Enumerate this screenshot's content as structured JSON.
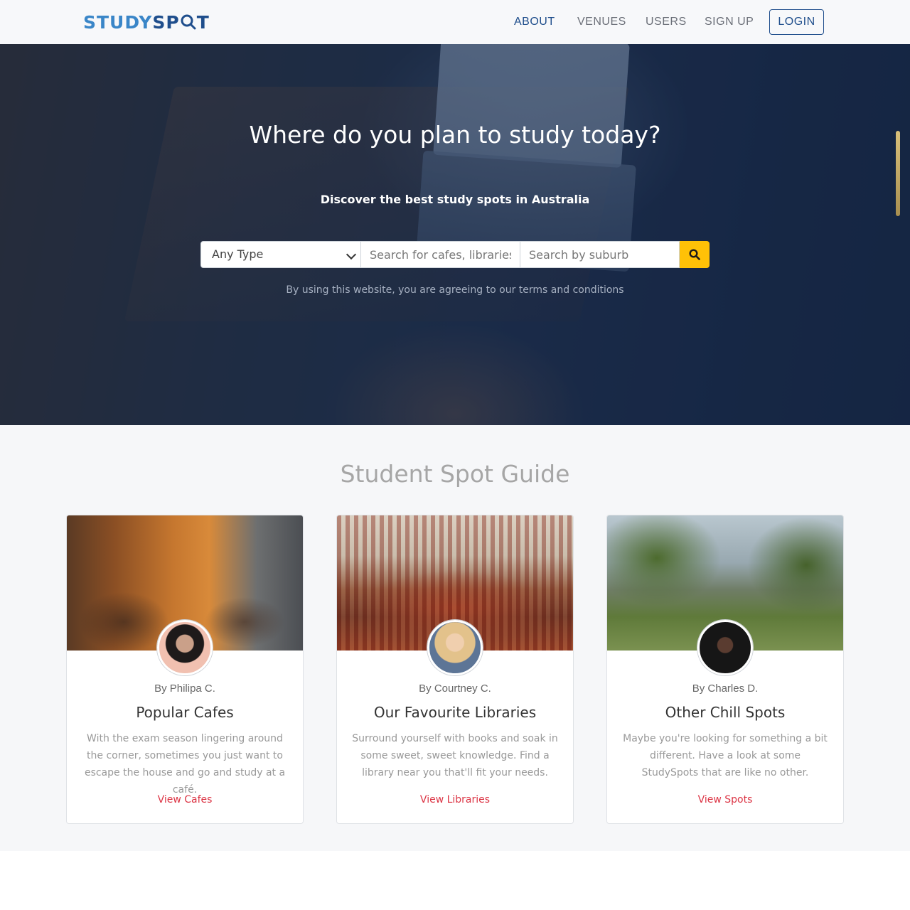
{
  "navbar": {
    "logo_part1": "STUDY",
    "logo_part2": "SP",
    "logo_part3": "T",
    "items": [
      {
        "label": "ABOUT"
      },
      {
        "label": "VENUES"
      },
      {
        "label": "USERS"
      },
      {
        "label": "SIGN UP"
      }
    ],
    "login_label": "LOGIN"
  },
  "hero": {
    "title": "Where do you plan to study today?",
    "subtitle": "Discover the best study spots in Australia",
    "search": {
      "type_selected": "Any Type",
      "query_placeholder": "Search for cafes, libraries...",
      "suburb_placeholder": "Search by suburb",
      "button_icon": "search-icon"
    },
    "terms": "By using this website, you are agreeing to our terms and conditions"
  },
  "guide": {
    "title": "Student Spot Guide",
    "cards": [
      {
        "author": "By Philipa C.",
        "title": "Popular Cafes",
        "description": "With the exam season lingering around the corner, sometimes you just want to escape the house and go and study at a café.",
        "link": "View Cafes"
      },
      {
        "author": "By Courtney C.",
        "title": "Our Favourite Libraries",
        "description": "Surround yourself with books and soak in some sweet, sweet knowledge. Find a library near you that'll fit your needs.",
        "link": "View Libraries"
      },
      {
        "author": "By Charles D.",
        "title": "Other Chill Spots",
        "description": "Maybe you're looking for something a bit different. Have a look at some StudySpots that are like no other.",
        "link": "View Spots"
      }
    ]
  },
  "colors": {
    "brand_dark": "#1f4e8c",
    "brand_light": "#3a86c8",
    "search_button": "#ffc107",
    "link": "#dc3545"
  }
}
